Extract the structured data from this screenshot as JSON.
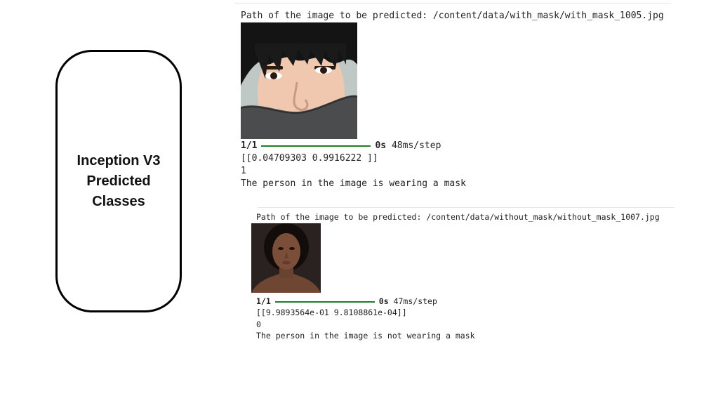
{
  "label_box": {
    "lines": [
      "Inception V3",
      "Predicted",
      "Classes"
    ]
  },
  "outputs": [
    {
      "path_line": "Path of the image to be predicted: /content/data/with_mask/with_mask_1005.jpg",
      "image_subject": "man with grey face mask",
      "progress_count": "1/1",
      "progress_time": "0s",
      "progress_step": "48ms/step",
      "probabilities": "[[0.04709303 0.9916222 ]]",
      "class_index": "1",
      "verdict": "The person in the image is wearing a mask"
    },
    {
      "path_line": "Path of the image to be predicted: /content/data/without_mask/without_mask_1007.jpg",
      "image_subject": "woman without face mask",
      "progress_count": "1/1",
      "progress_time": "0s",
      "progress_step": "47ms/step",
      "probabilities": "[[9.9893564e-01 9.8108861e-04]]",
      "class_index": "0",
      "verdict": "The person in the image is not wearing a mask"
    }
  ],
  "colors": {
    "progress_bar": "#1b7e2c"
  }
}
